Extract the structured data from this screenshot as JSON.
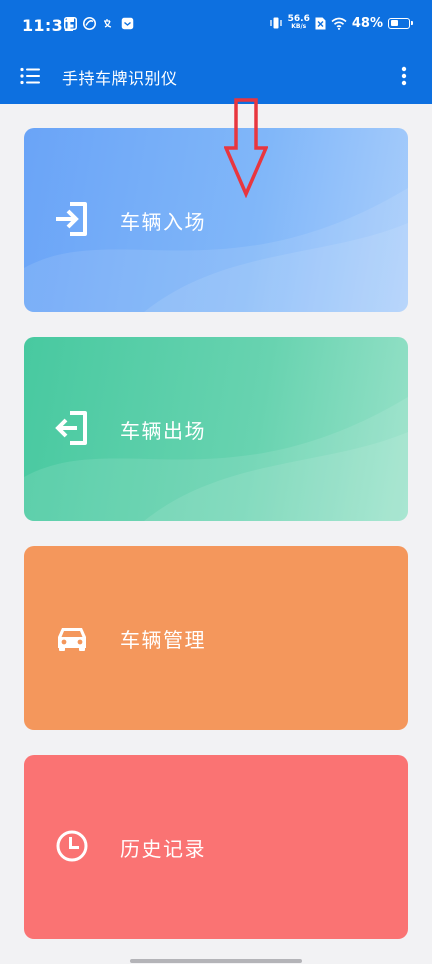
{
  "status_bar": {
    "time": "11:31",
    "net_speed_value": "56.6",
    "net_speed_unit": "KB/s",
    "battery_text": "48%",
    "battery_level": 0.48
  },
  "app_bar": {
    "title": "手持车牌识别仪",
    "menu_icon": "hamburger-menu-icon",
    "more_icon": "more-vert-icon"
  },
  "cards": [
    {
      "label": "车辆入场",
      "icon": "login-enter-icon",
      "color": "#6aa4f7"
    },
    {
      "label": "车辆出场",
      "icon": "logout-exit-icon",
      "color": "#48c9a0"
    },
    {
      "label": "车辆管理",
      "icon": "car-icon",
      "color": "#f4975c"
    },
    {
      "label": "历史记录",
      "icon": "clock-history-icon",
      "color": "#fa7373"
    }
  ],
  "annotation": {
    "arrow_color": "#e8363f"
  }
}
